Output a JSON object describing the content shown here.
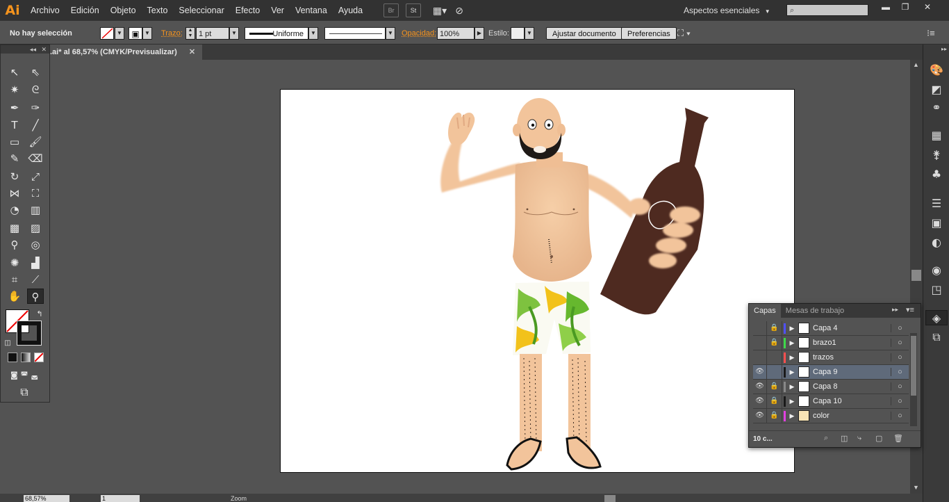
{
  "app": {
    "logo": "Ai",
    "workspace": "Aspectos esenciales"
  },
  "menu": [
    {
      "label": "Archivo"
    },
    {
      "label": "Edición"
    },
    {
      "label": "Objeto"
    },
    {
      "label": "Texto"
    },
    {
      "label": "Seleccionar"
    },
    {
      "label": "Efecto"
    },
    {
      "label": "Ver"
    },
    {
      "label": "Ventana"
    },
    {
      "label": "Ayuda"
    }
  ],
  "menu_icons": {
    "bridge": "Br",
    "stock": "St"
  },
  "control": {
    "selection": "No hay selección",
    "stroke_label": "Trazo:",
    "stroke_value": "1 pt",
    "stroke_profile": "Uniforme",
    "opacity_label": "Opacidad:",
    "opacity_value": "100%",
    "style_label": "Estilo:",
    "fit_button": "Ajustar documento",
    "prefs_button": "Preferencias"
  },
  "document": {
    "tab_title": ".ai* al 68,57% (CMYK/Previsualizar)"
  },
  "status": {
    "zoom": "68,57%",
    "artboard": "1",
    "tool": "Zoom"
  },
  "layers": {
    "tabs": [
      {
        "label": "Capas"
      },
      {
        "label": "Mesas de trabajo"
      }
    ],
    "count": "10 c...",
    "items": [
      {
        "name": "Capa 4",
        "visible": false,
        "locked": true,
        "color": "#4f4fff",
        "selected": false
      },
      {
        "name": "brazo1",
        "visible": false,
        "locked": true,
        "color": "#3fd94a",
        "selected": false
      },
      {
        "name": "trazos",
        "visible": false,
        "locked": false,
        "color": "#ff4f4f",
        "selected": false
      },
      {
        "name": "Capa 9",
        "visible": true,
        "locked": false,
        "color": "#1a1a1a",
        "selected": true
      },
      {
        "name": "Capa 8",
        "visible": true,
        "locked": true,
        "color": "#888888",
        "selected": false
      },
      {
        "name": "Capa 10",
        "visible": true,
        "locked": true,
        "color": "#1a1a1a",
        "selected": false
      },
      {
        "name": "color",
        "visible": true,
        "locked": true,
        "color": "#e040e0",
        "selected": false
      }
    ]
  },
  "colors": {
    "accent": "#f7941d",
    "skin": "#f2c49b",
    "bottle": "#4e2a20",
    "selected_row": "#5f6a7a"
  }
}
